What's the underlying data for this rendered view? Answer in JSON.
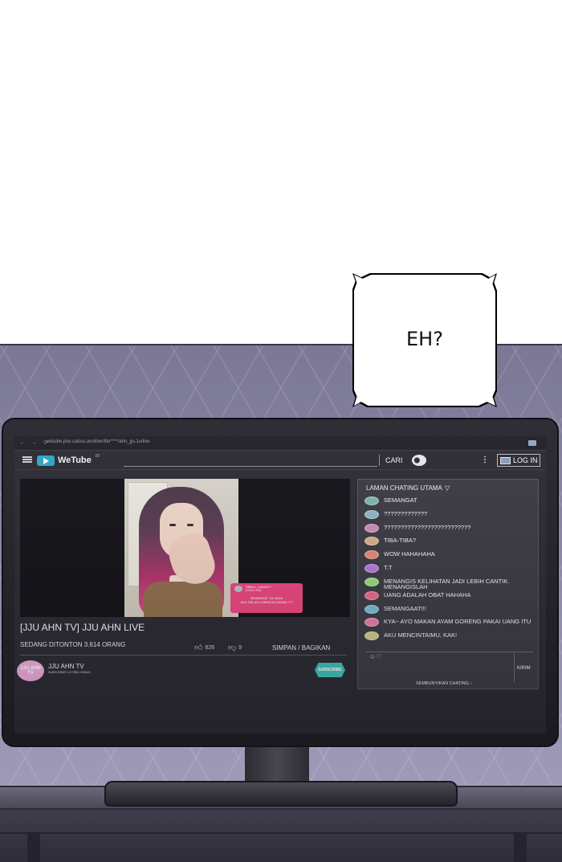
{
  "speech_bubble": {
    "text": "EH?"
  },
  "browser": {
    "nav": "← → ⟳",
    "url": "wetube.jine.cabsu.another/life****/ahn_jju.1u/live"
  },
  "header": {
    "logo_text": "WeTube",
    "logo_sup": "ID",
    "search_label": "CARI",
    "login_label": "LOG IN"
  },
  "video": {
    "donation": {
      "name": "TIBBUL_HANDS**",
      "sub": "10000 USD",
      "message_line1": "SEMANGAT JJU AHN!",
      "message_line2": "AKU SELALU MENDUKUNGMU T.T"
    },
    "title": "[JJU AHN TV] JJU AHN LIVE",
    "viewers": "SEDANG DITONTON 3.614 ORANG",
    "likes": "626",
    "dislikes": "9",
    "save_share": "SIMPAN / BAGIKAN",
    "channel": {
      "avatar_text": "JJU AHN TV",
      "name": "JJU AHN TV",
      "subscribers": "SUBSCRIBER 120 RIBU ORANG",
      "subscribe_label": "SUBSCRIBE"
    }
  },
  "chat": {
    "header": "LAMAN CHATING UTAMA",
    "caret": "▽",
    "messages": [
      {
        "text": "SEMANGAT",
        "avatar_color": "#7fb8a8"
      },
      {
        "text": "?????????????",
        "avatar_color": "#8fb8c8"
      },
      {
        "text": "??????????????????????????",
        "avatar_color": "#c88fb8"
      },
      {
        "text": "TIBA-TIBA?",
        "avatar_color": "#d8b088"
      },
      {
        "text": "WOW HAHAHAHA",
        "avatar_color": "#e88878"
      },
      {
        "text": "T.T",
        "avatar_color": "#b878d8"
      },
      {
        "text": "MENANGIS KELIHATAN JADI LEBIH CANTIK. MENANGISLAH",
        "avatar_color": "#98d878"
      },
      {
        "text": "UANG ADALAH OBAT HAHAHA",
        "avatar_color": "#e86888"
      },
      {
        "text": "SEMANGAAT!!!",
        "avatar_color": "#78b8d8"
      },
      {
        "text": "KYA~ AYO MAKAN AYAM GORENG PAKAI UANG ITU",
        "avatar_color": "#e878a8"
      },
      {
        "text": "AKU MENCINTAIMU, KAK!",
        "avatar_color": "#c8c888"
      }
    ],
    "emoji": "☺♡",
    "send_label": "KIRIM",
    "hide_label": "SEMBUNYIKAN CHATING ↑"
  },
  "colors": {
    "wall": "#8d8aa6",
    "brand": "#2aa7c4",
    "donation": "#e8467e",
    "subscribe": "#3dbcb6"
  }
}
